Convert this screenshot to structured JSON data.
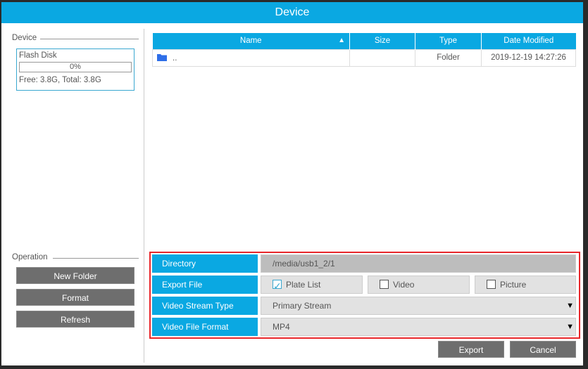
{
  "title": "Device",
  "device": {
    "legend": "Device",
    "disk_name": "Flash Disk",
    "usage": "0%",
    "usage_fraction": 0,
    "space": "Free: 3.8G, Total: 3.8G"
  },
  "operation": {
    "legend": "Operation",
    "new_folder": "New Folder",
    "format": "Format",
    "refresh": "Refresh"
  },
  "table": {
    "headers": {
      "name": "Name",
      "size": "Size",
      "type": "Type",
      "date": "Date Modified"
    },
    "rows": [
      {
        "name": "..",
        "size": "",
        "type": "Folder",
        "date": "2019-12-19 14:27:26",
        "icon": "folder-icon"
      }
    ]
  },
  "form": {
    "directory_label": "Directory",
    "directory_value": "/media/usb1_2/1",
    "export_label": "Export File",
    "plate_list": "Plate List",
    "video": "Video",
    "picture": "Picture",
    "stream_label": "Video Stream Type",
    "stream_value": "Primary Stream",
    "format_label": "Video File Format",
    "format_value": "MP4"
  },
  "buttons": {
    "export": "Export",
    "cancel": "Cancel"
  }
}
